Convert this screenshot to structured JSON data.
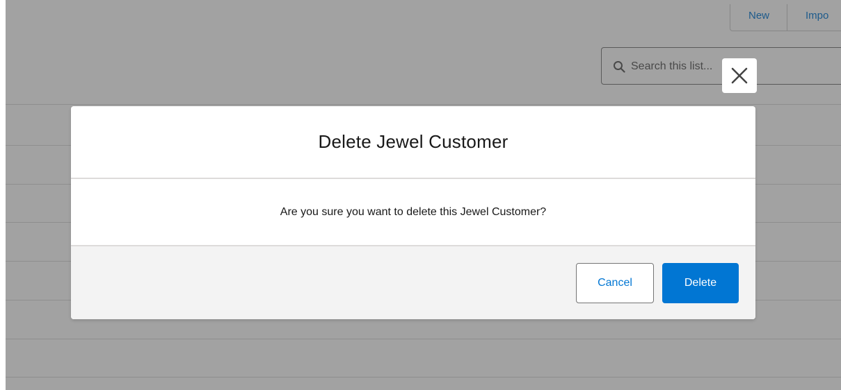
{
  "background": {
    "toolbar": {
      "new_label": "New",
      "import_label": "Impo"
    },
    "search": {
      "placeholder": "Search this list..."
    }
  },
  "modal": {
    "title": "Delete Jewel Customer",
    "message": "Are you sure you want to delete this Jewel Customer?",
    "cancel_label": "Cancel",
    "delete_label": "Delete",
    "close_icon": "close-icon"
  },
  "colors": {
    "brand_blue": "#0176d3",
    "backdrop": "rgba(60,60,60,0.48)",
    "footer_bg": "#f3f3f3"
  }
}
